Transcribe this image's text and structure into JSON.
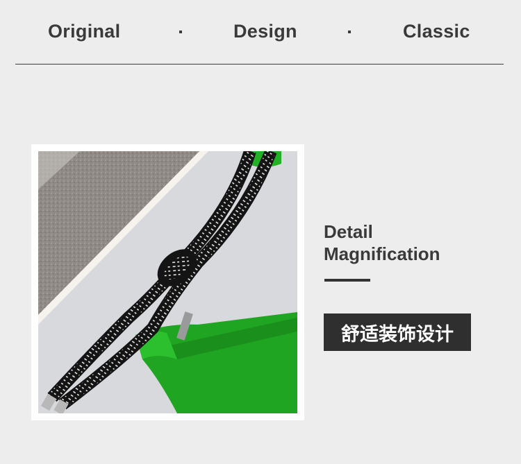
{
  "header": {
    "words": [
      "Original",
      "Design",
      "Classic"
    ]
  },
  "detail": {
    "title_line1": "Detail",
    "title_line2": "Magnification",
    "badge": "舒适装饰设计"
  },
  "photo": {
    "subject": "bag-strap-detail-photo",
    "colors": {
      "bag": "#22b024",
      "cord": "#1a1a1a",
      "background": "#d4d6da"
    }
  },
  "colors": {
    "page_bg": "#ededed",
    "text": "#3a3a3a",
    "badge_bg": "#2f2f2f"
  }
}
